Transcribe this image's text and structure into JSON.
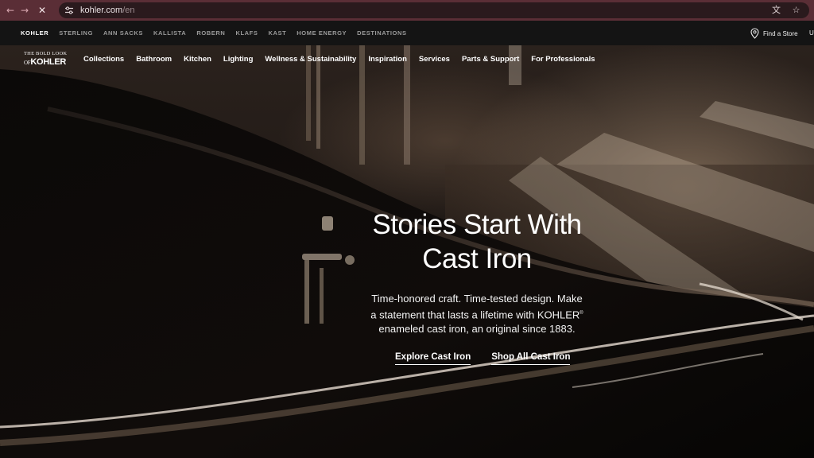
{
  "browser": {
    "url_host": "kohler.com",
    "url_path": "/en",
    "back_icon": "arrow-left-icon",
    "forward_icon": "arrow-right-icon",
    "stop_icon": "close-icon",
    "theme_color": "#5a2e36"
  },
  "brands": [
    "KOHLER",
    "STERLING",
    "ANN SACKS",
    "KALLISTA",
    "ROBERN",
    "KLAFS",
    "KAST",
    "HOME ENERGY",
    "DESTINATIONS"
  ],
  "utility": {
    "find_store": "Find a Store",
    "extra": "U"
  },
  "logo": {
    "line1": "THE BOLD LOOK",
    "line2_prefix": "OF",
    "line2_brand": "KOHLER"
  },
  "nav": [
    "Collections",
    "Bathroom",
    "Kitchen",
    "Lighting",
    "Wellness & Sustainability",
    "Inspiration",
    "Services",
    "Parts & Support",
    "For Professionals"
  ],
  "hero": {
    "title_line1": "Stories Start With",
    "title_line2": "Cast Iron",
    "desc_line1": "Time-honored craft. Time-tested design. Make",
    "desc_line2": "a statement that lasts a lifetime with KOHLER",
    "desc_reg": "®",
    "desc_line3": "enameled cast iron, an original since 1883.",
    "cta_primary": "Explore Cast Iron",
    "cta_secondary": "Shop All Cast Iron"
  }
}
